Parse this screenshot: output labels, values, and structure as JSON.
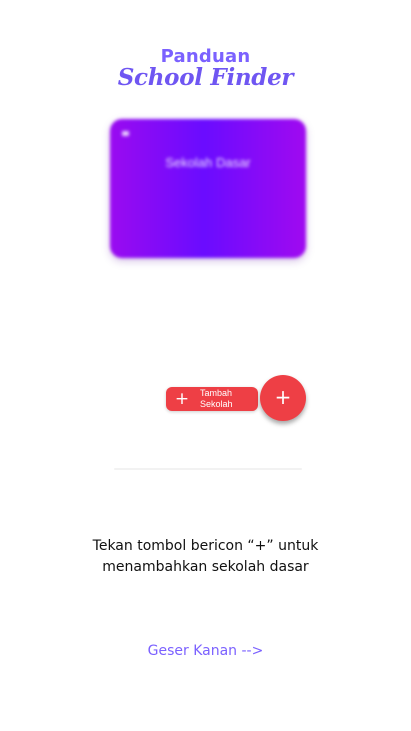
{
  "header": {
    "title_top": "Panduan",
    "title_script": "School Finder"
  },
  "preview_card": {
    "label": "Sekolah Dasar",
    "gradient_colors": [
      "#9a0bf0",
      "#6a0cff",
      "#a00af0"
    ]
  },
  "add_fab": {
    "label_line1": "Tambah",
    "label_line2": "Sekolah",
    "icon": "plus-icon",
    "glyph": "+",
    "color": "#ee3f45"
  },
  "instruction": {
    "line1": "Tekan tombol bericon “+” untuk",
    "line2": "menambahkan sekolah dasar"
  },
  "navigation": {
    "swipe_label": "Geser Kanan -->",
    "accent_color": "#7b61ff"
  }
}
